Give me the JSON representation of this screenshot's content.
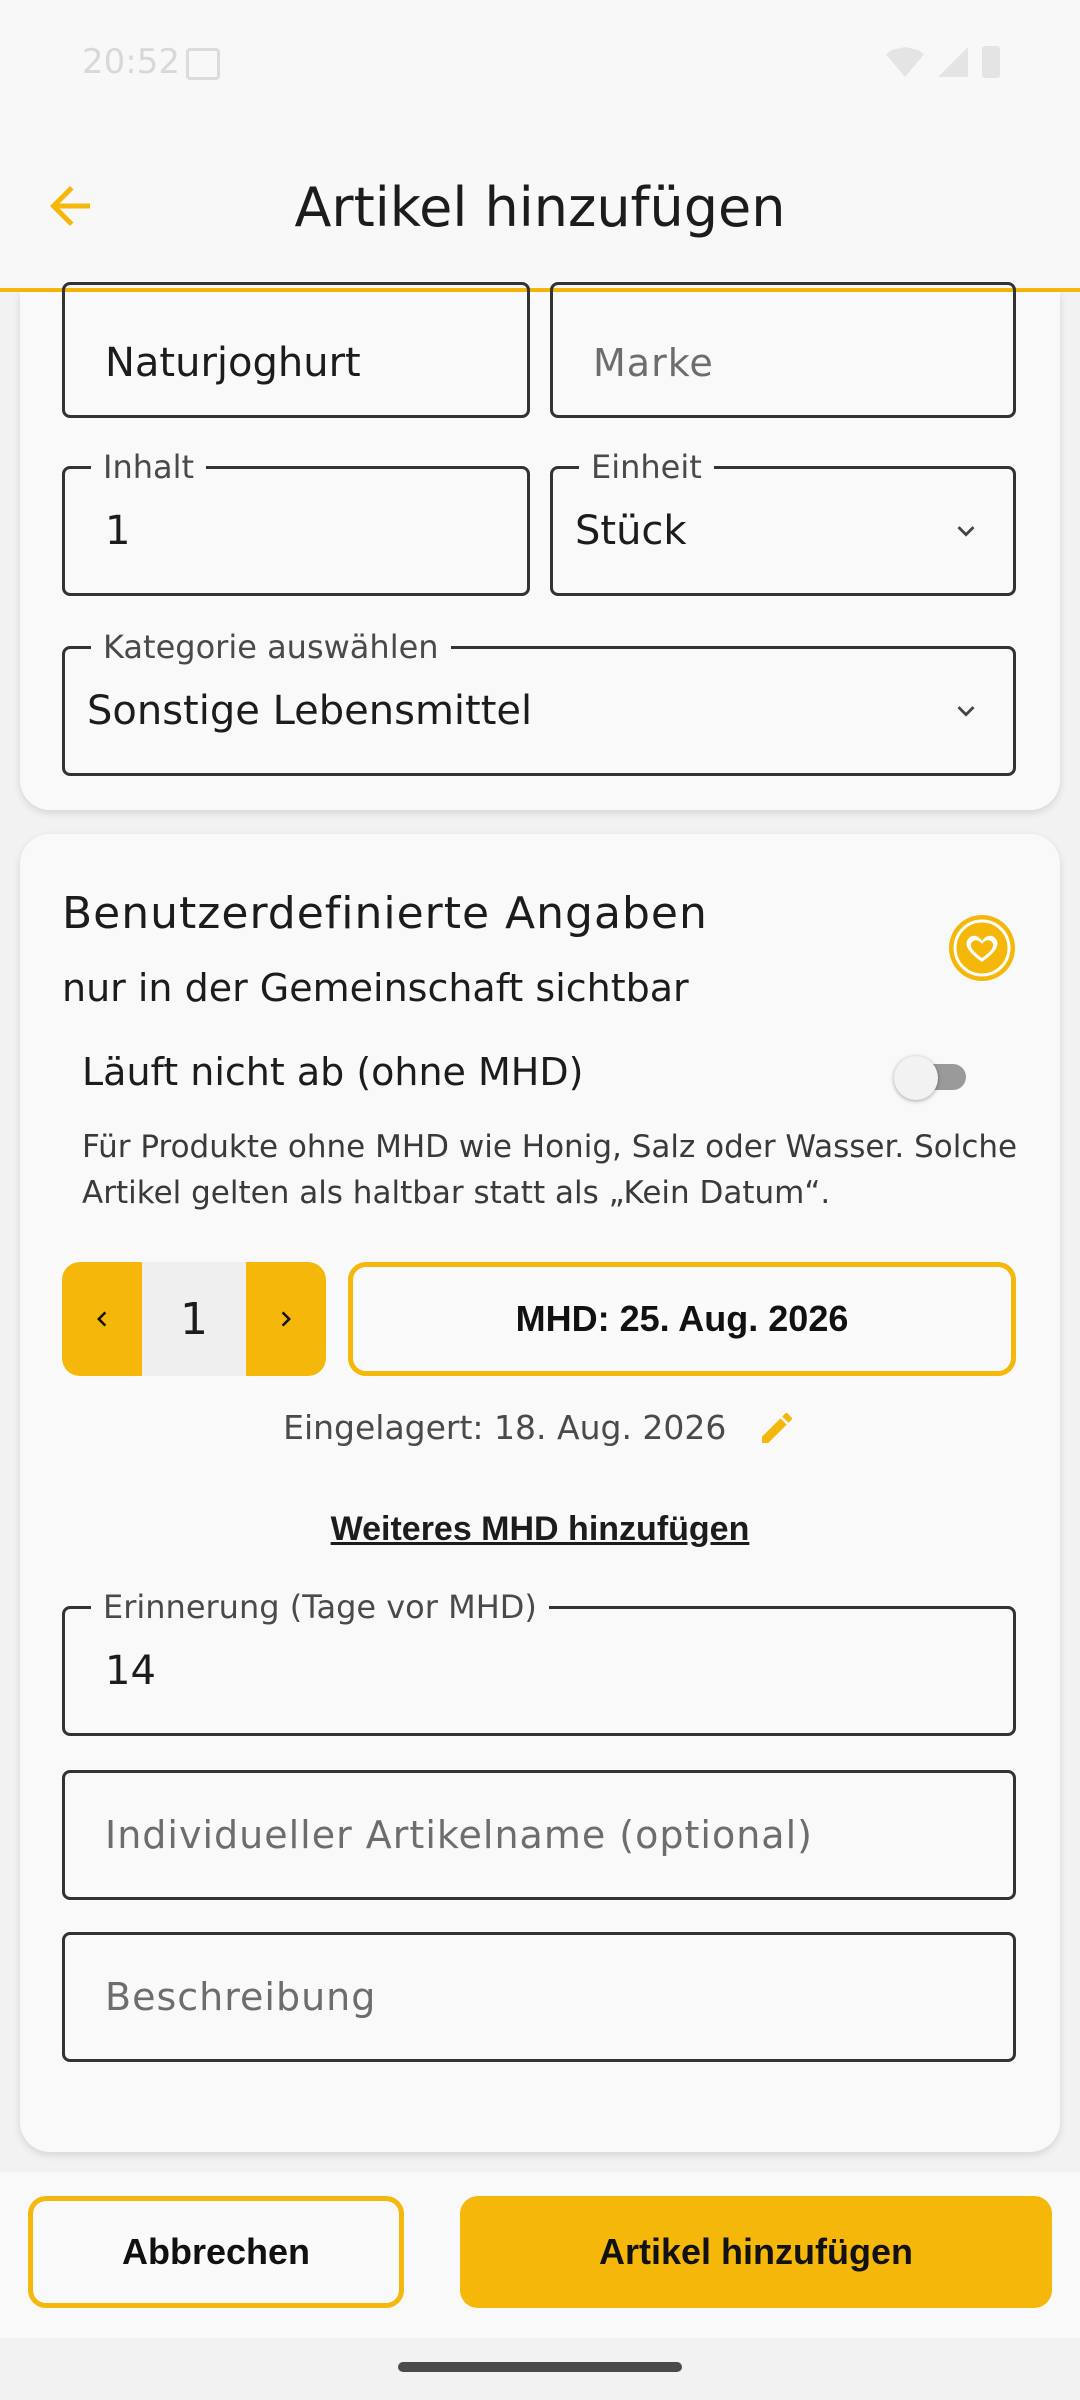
{
  "status_bar": {
    "time": "20:52"
  },
  "app_bar": {
    "title": "Artikel hinzufügen"
  },
  "product": {
    "name_value": "Naturjoghurt",
    "brand_placeholder": "Marke",
    "content_label": "Inhalt",
    "content_value": "1",
    "unit_label": "Einheit",
    "unit_value": "Stück",
    "category_label": "Kategorie auswählen",
    "category_value": "Sonstige Lebensmittel"
  },
  "custom": {
    "title": "Benutzerdefinierte Angaben",
    "subtitle": "nur in der Gemeinschaft sichtbar",
    "no_expiry_label": "Läuft nicht ab (ohne MHD)",
    "no_expiry_on": false,
    "helper_text": "Für Produkte ohne MHD wie Honig, Salz oder Wasser. Solche Artikel gelten als haltbar statt als „Kein Datum“.",
    "quantity": "1",
    "mhd_button": "MHD: 25. Aug. 2026",
    "stored_text": "Eingelagert: 18. Aug. 2026",
    "add_mhd_link": "Weiteres MHD hinzufügen",
    "reminder_label": "Erinnerung (Tage vor MHD)",
    "reminder_value": "14",
    "custom_name_placeholder": "Individueller Artikelname (optional)",
    "description_placeholder": "Beschreibung"
  },
  "actions": {
    "cancel": "Abbrechen",
    "add": "Artikel hinzufügen"
  },
  "colors": {
    "accent": "#f5b70a",
    "background": "#f2f2f2"
  },
  "icons": [
    "back-arrow-icon",
    "chevron-down-icon",
    "heart-community-icon",
    "chevron-left-icon",
    "chevron-right-icon",
    "pencil-icon"
  ]
}
